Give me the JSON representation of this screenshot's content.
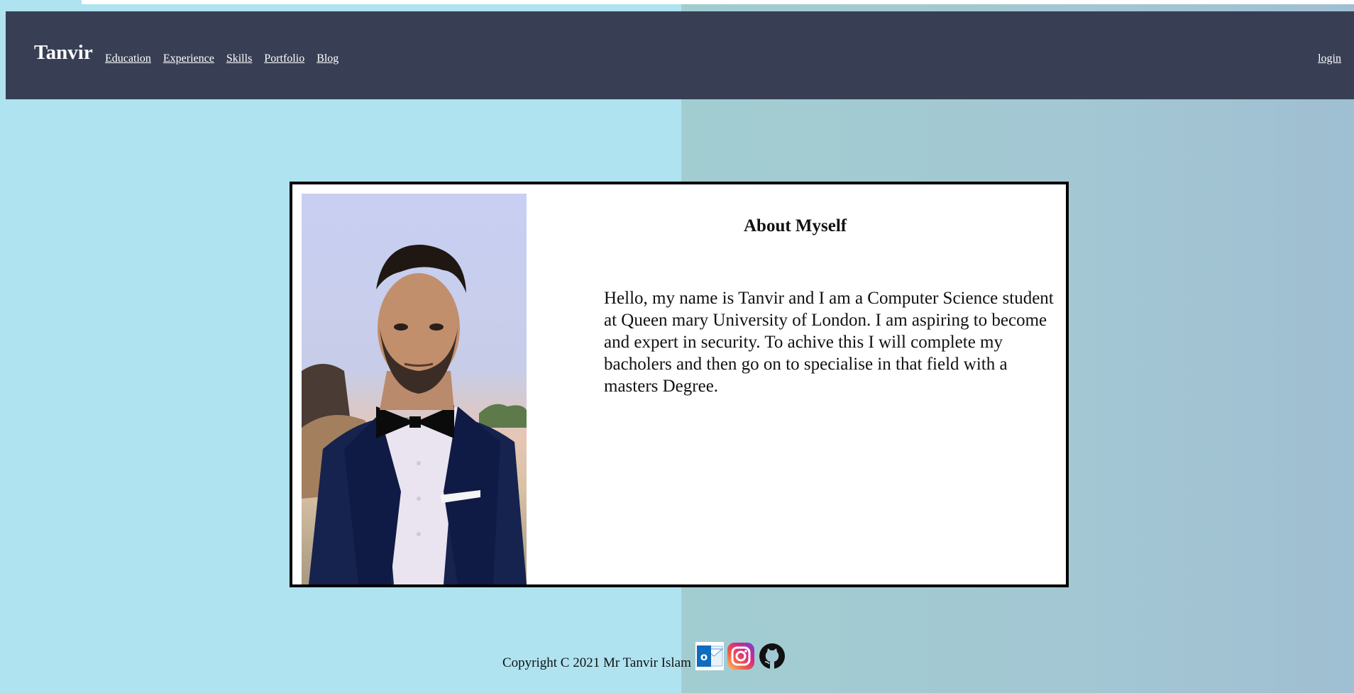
{
  "header": {
    "brand": "Tanvir",
    "nav": [
      "Education",
      "Experience",
      "Skills",
      "Portfolio",
      "Blog"
    ],
    "login": "login"
  },
  "about": {
    "title": "About Myself",
    "text": "Hello, my name is Tanvir and I am a Computer Science student at Queen mary University of London. I am aspiring to become and expert in security. To achive this I will complete my bacholers and then go on to specialise in that field with a masters Degree."
  },
  "footer": {
    "copyright": "Copyright C 2021 Mr Tanvir Islam"
  },
  "icons": {
    "outlook": "outlook-icon",
    "instagram": "instagram-icon",
    "github": "github-icon"
  },
  "colors": {
    "navbar": "#383f55",
    "background_left": "#afe3f0",
    "background_right": "#a1cdd1"
  }
}
